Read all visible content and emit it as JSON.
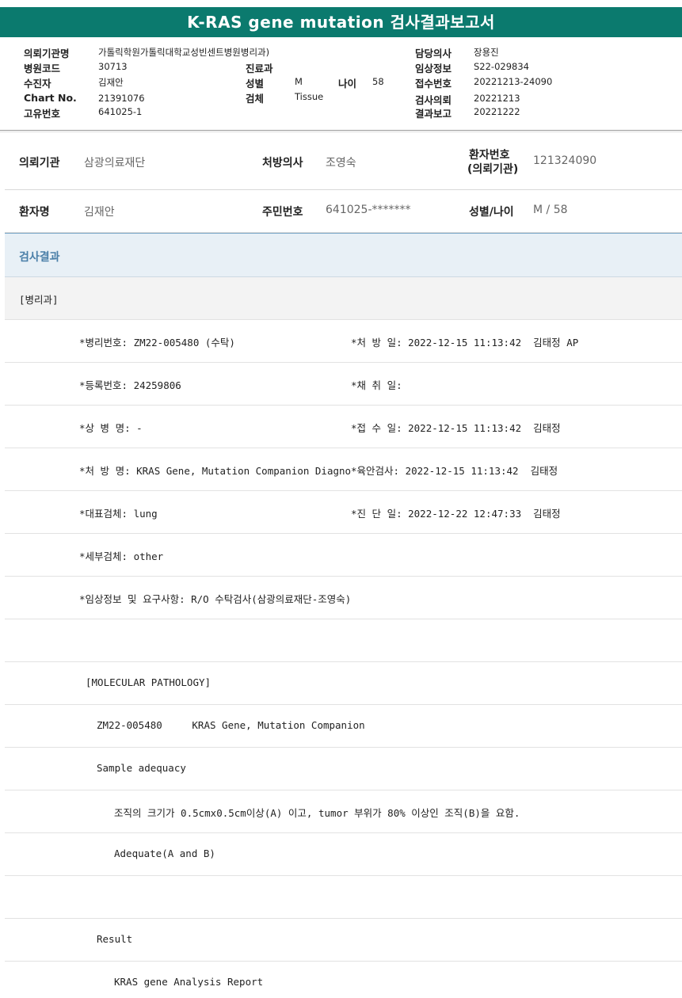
{
  "title": "K-RAS gene mutation 검사결과보고서",
  "header": {
    "left": [
      {
        "label": "의뢰기관명",
        "value": "가톨릭학원가톨릭대학교성빈센트병원병리과)"
      },
      {
        "label": "병원코드",
        "value": "30713"
      },
      {
        "label": "수진자",
        "value": "김재안"
      },
      {
        "label": "Chart No.",
        "value": "21391076"
      },
      {
        "label": "고유번호",
        "value": "641025-1"
      }
    ],
    "mid": [
      {
        "label": "진료과",
        "value": ""
      },
      {
        "label": "성별",
        "value": "M"
      },
      {
        "label": "나이",
        "value": "58"
      },
      {
        "label": "검체",
        "value": "Tissue"
      }
    ],
    "right": [
      {
        "label": "담당의사",
        "value": "장용진"
      },
      {
        "label": "임상정보",
        "value": "S22-029834"
      },
      {
        "label": "접수번호",
        "value": "20221213-24090"
      },
      {
        "label": "검사의뢰",
        "value": "20221213"
      },
      {
        "label": "결과보고",
        "value": "20221222"
      }
    ]
  },
  "info": {
    "row1": [
      {
        "label": "의뢰기관",
        "value": "삼광의료재단"
      },
      {
        "label": "처방의사",
        "value": "조영숙"
      },
      {
        "label": "환자번호",
        "label2": "(의뢰기관)",
        "value": "121324090"
      }
    ],
    "row2": [
      {
        "label": "환자명",
        "value": "김재안"
      },
      {
        "label": "주민번호",
        "value": "641025-*******"
      },
      {
        "label": "성별/나이",
        "value": "M / 58"
      }
    ]
  },
  "results_title": "검사결과",
  "lines": [
    {
      "a": "[병리과]",
      "b": ""
    },
    {
      "a": "*병리번호: ZM22-005480 (수탁)",
      "b": "*처 방 일: 2022-12-15 11:13:42  김태정 AP"
    },
    {
      "a": "*등록번호: 24259806",
      "b": "*채 취 일:"
    },
    {
      "a": "*상 병 명: -",
      "b": "*접 수 일: 2022-12-15 11:13:42  김태정"
    },
    {
      "a": "*처 방 명: KRAS Gene, Mutation Companion Diagno",
      "b": "*육안검사: 2022-12-15 11:13:42  김태정"
    },
    {
      "a": "*대표검체: lung",
      "b": "*진 단 일: 2022-12-22 12:47:33  김태정"
    },
    {
      "a": "*세부검체: other",
      "b": ""
    },
    {
      "a": "*임상정보 및 요구사항: R/O 수탁검사(삼광의료재단-조영숙)",
      "b": ""
    },
    {
      "a": "",
      "b": ""
    },
    {
      "a": "[MOLECULAR PATHOLOGY]",
      "b": ""
    },
    {
      "a": "ZM22-005480     KRAS Gene, Mutation Companion",
      "b": ""
    },
    {
      "a": "Sample adequacy",
      "b": ""
    },
    {
      "a": "조직의 크기가 0.5cmx0.5cm이상(A) 이고, tumor 부위가 80% 이상인 조직(B)을 요함.",
      "b": ""
    },
    {
      "a": "Adequate(A and B)",
      "b": ""
    },
    {
      "a": "",
      "b": ""
    },
    {
      "a": "Result",
      "b": ""
    },
    {
      "a": "KRAS gene Analysis Report",
      "b": ""
    }
  ]
}
